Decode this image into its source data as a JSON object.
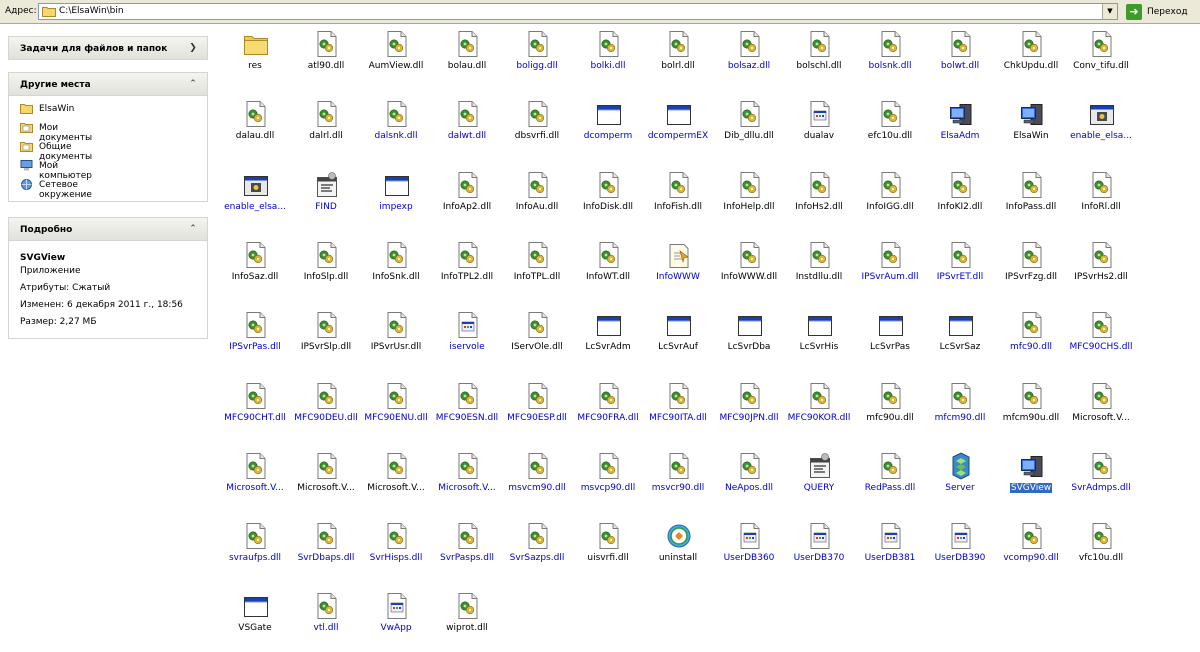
{
  "address": {
    "label": "Адрес:",
    "path": "C:\\ElsaWin\\bin",
    "go_label": "Переход"
  },
  "taskpane": {
    "file_tasks_title": "Задачи для файлов и папок",
    "other_places_title": "Другие места",
    "places": [
      {
        "label": "ElsaWin",
        "icon": "folder-icon"
      },
      {
        "label": "Мои документы",
        "icon": "my-documents-icon"
      },
      {
        "label": "Общие документы",
        "icon": "shared-documents-icon"
      },
      {
        "label": "Мой компьютер",
        "icon": "my-computer-icon"
      },
      {
        "label": "Сетевое окружение",
        "icon": "network-icon"
      }
    ],
    "details_title": "Подробно",
    "details": {
      "name": "SVGView",
      "type": "Приложение",
      "attributes": "Атрибуты: Сжатый",
      "modified": "Изменен: 6 декабря 2011 г., 18:56",
      "size": "Размер: 2,27 МБ"
    }
  },
  "colors": {
    "compressed_text": "#0000cc",
    "selection": "#316ac5",
    "toolbar": "#ece9d8"
  },
  "files": [
    {
      "name": "res",
      "type": "folder",
      "blue": false
    },
    {
      "name": "atl90.dll",
      "type": "dll",
      "blue": false
    },
    {
      "name": "AumView.dll",
      "type": "dll",
      "blue": false
    },
    {
      "name": "bolau.dll",
      "type": "dll",
      "blue": false
    },
    {
      "name": "boligg.dll",
      "type": "dll",
      "blue": true
    },
    {
      "name": "bolki.dll",
      "type": "dll",
      "blue": true
    },
    {
      "name": "bolrl.dll",
      "type": "dll",
      "blue": false
    },
    {
      "name": "bolsaz.dll",
      "type": "dll",
      "blue": true
    },
    {
      "name": "bolschl.dll",
      "type": "dll",
      "blue": false
    },
    {
      "name": "bolsnk.dll",
      "type": "dll",
      "blue": true
    },
    {
      "name": "bolwt.dll",
      "type": "dll",
      "blue": true
    },
    {
      "name": "ChkUpdu.dll",
      "type": "dll",
      "blue": false
    },
    {
      "name": "Conv_tifu.dll",
      "type": "dll",
      "blue": false
    },
    {
      "name": "dalau.dll",
      "type": "dll",
      "blue": false
    },
    {
      "name": "dalrl.dll",
      "type": "dll",
      "blue": false
    },
    {
      "name": "dalsnk.dll",
      "type": "dll",
      "blue": true
    },
    {
      "name": "dalwt.dll",
      "type": "dll",
      "blue": true
    },
    {
      "name": "dbsvrfi.dll",
      "type": "dll",
      "blue": false
    },
    {
      "name": "dcomperm",
      "type": "window",
      "blue": true
    },
    {
      "name": "dcompermEX",
      "type": "window",
      "blue": true
    },
    {
      "name": "Dib_dllu.dll",
      "type": "dll",
      "blue": false
    },
    {
      "name": "dualav",
      "type": "doc",
      "blue": false
    },
    {
      "name": "efc10u.dll",
      "type": "dll",
      "blue": false
    },
    {
      "name": "ElsaAdm",
      "type": "computer",
      "blue": true
    },
    {
      "name": "ElsaWin",
      "type": "computer",
      "blue": false
    },
    {
      "name": "enable_elsa...",
      "type": "appwin",
      "blue": true
    },
    {
      "name": "enable_elsa...",
      "type": "appwin",
      "blue": true
    },
    {
      "name": "FIND",
      "type": "batch",
      "blue": true
    },
    {
      "name": "impexp",
      "type": "window",
      "blue": true
    },
    {
      "name": "InfoAp2.dll",
      "type": "dll",
      "blue": false
    },
    {
      "name": "InfoAu.dll",
      "type": "dll",
      "blue": false
    },
    {
      "name": "InfoDisk.dll",
      "type": "dll",
      "blue": false
    },
    {
      "name": "InfoFish.dll",
      "type": "dll",
      "blue": false
    },
    {
      "name": "InfoHelp.dll",
      "type": "dll",
      "blue": false
    },
    {
      "name": "InfoHs2.dll",
      "type": "dll",
      "blue": false
    },
    {
      "name": "InfoIGG.dll",
      "type": "dll",
      "blue": false
    },
    {
      "name": "InfoKI2.dll",
      "type": "dll",
      "blue": false
    },
    {
      "name": "InfoPass.dll",
      "type": "dll",
      "blue": false
    },
    {
      "name": "InfoRl.dll",
      "type": "dll",
      "blue": false
    },
    {
      "name": "InfoSaz.dll",
      "type": "dll",
      "blue": false
    },
    {
      "name": "InfoSlp.dll",
      "type": "dll",
      "blue": false
    },
    {
      "name": "InfoSnk.dll",
      "type": "dll",
      "blue": false
    },
    {
      "name": "InfoTPL2.dll",
      "type": "dll",
      "blue": false
    },
    {
      "name": "InfoTPL.dll",
      "type": "dll",
      "blue": false
    },
    {
      "name": "InfoWT.dll",
      "type": "dll",
      "blue": false
    },
    {
      "name": "InfoWWW",
      "type": "wizard",
      "blue": true
    },
    {
      "name": "InfoWWW.dll",
      "type": "dll",
      "blue": false
    },
    {
      "name": "Instdllu.dll",
      "type": "dll",
      "blue": false
    },
    {
      "name": "IPSvrAum.dll",
      "type": "dll",
      "blue": true
    },
    {
      "name": "IPSvrET.dll",
      "type": "dll",
      "blue": true
    },
    {
      "name": "IPSvrFzg.dll",
      "type": "dll",
      "blue": false
    },
    {
      "name": "IPSvrHs2.dll",
      "type": "dll",
      "blue": false
    },
    {
      "name": "IPSvrPas.dll",
      "type": "dll",
      "blue": true
    },
    {
      "name": "IPSvrSlp.dll",
      "type": "dll",
      "blue": false
    },
    {
      "name": "IPSvrUsr.dll",
      "type": "dll",
      "blue": false
    },
    {
      "name": "iservole",
      "type": "doc",
      "blue": true
    },
    {
      "name": "IServOle.dll",
      "type": "dll",
      "blue": false
    },
    {
      "name": "LcSvrAdm",
      "type": "window",
      "blue": false
    },
    {
      "name": "LcSvrAuf",
      "type": "window",
      "blue": false
    },
    {
      "name": "LcSvrDba",
      "type": "window",
      "blue": false
    },
    {
      "name": "LcSvrHis",
      "type": "window",
      "blue": false
    },
    {
      "name": "LcSvrPas",
      "type": "window",
      "blue": false
    },
    {
      "name": "LcSvrSaz",
      "type": "window",
      "blue": false
    },
    {
      "name": "mfc90.dll",
      "type": "dll",
      "blue": true
    },
    {
      "name": "MFC90CHS.dll",
      "type": "dll",
      "blue": true
    },
    {
      "name": "MFC90CHT.dll",
      "type": "dll",
      "blue": true
    },
    {
      "name": "MFC90DEU.dll",
      "type": "dll",
      "blue": true
    },
    {
      "name": "MFC90ENU.dll",
      "type": "dll",
      "blue": true
    },
    {
      "name": "MFC90ESN.dll",
      "type": "dll",
      "blue": true
    },
    {
      "name": "MFC90ESP.dll",
      "type": "dll",
      "blue": true
    },
    {
      "name": "MFC90FRA.dll",
      "type": "dll",
      "blue": true
    },
    {
      "name": "MFC90ITA.dll",
      "type": "dll",
      "blue": true
    },
    {
      "name": "MFC90JPN.dll",
      "type": "dll",
      "blue": true
    },
    {
      "name": "MFC90KOR.dll",
      "type": "dll",
      "blue": true
    },
    {
      "name": "mfc90u.dll",
      "type": "dll",
      "blue": false
    },
    {
      "name": "mfcm90.dll",
      "type": "dll",
      "blue": true
    },
    {
      "name": "mfcm90u.dll",
      "type": "dll",
      "blue": false
    },
    {
      "name": "Microsoft.V...",
      "type": "dll",
      "blue": false
    },
    {
      "name": "Microsoft.V...",
      "type": "dll",
      "blue": true
    },
    {
      "name": "Microsoft.V...",
      "type": "dll",
      "blue": false
    },
    {
      "name": "Microsoft.V...",
      "type": "dll",
      "blue": false
    },
    {
      "name": "Microsoft.V...",
      "type": "dll",
      "blue": true
    },
    {
      "name": "msvcm90.dll",
      "type": "dll",
      "blue": true
    },
    {
      "name": "msvcp90.dll",
      "type": "dll",
      "blue": true
    },
    {
      "name": "msvcr90.dll",
      "type": "dll",
      "blue": true
    },
    {
      "name": "NeApos.dll",
      "type": "dll",
      "blue": true
    },
    {
      "name": "QUERY",
      "type": "batch",
      "blue": true
    },
    {
      "name": "RedPass.dll",
      "type": "dll",
      "blue": true
    },
    {
      "name": "Server",
      "type": "server",
      "blue": true
    },
    {
      "name": "SVGView",
      "type": "computer",
      "blue": false,
      "selected": true
    },
    {
      "name": "SvrAdmps.dll",
      "type": "dll",
      "blue": true
    },
    {
      "name": "svraufps.dll",
      "type": "dll",
      "blue": true
    },
    {
      "name": "SvrDbaps.dll",
      "type": "dll",
      "blue": true
    },
    {
      "name": "SvrHisps.dll",
      "type": "dll",
      "blue": true
    },
    {
      "name": "SvrPasps.dll",
      "type": "dll",
      "blue": true
    },
    {
      "name": "SvrSazps.dll",
      "type": "dll",
      "blue": true
    },
    {
      "name": "uisvrfi.dll",
      "type": "dll",
      "blue": false
    },
    {
      "name": "uninstall",
      "type": "globe",
      "blue": false
    },
    {
      "name": "UserDB360",
      "type": "doc",
      "blue": true
    },
    {
      "name": "UserDB370",
      "type": "doc",
      "blue": true
    },
    {
      "name": "UserDB381",
      "type": "doc",
      "blue": true
    },
    {
      "name": "UserDB390",
      "type": "doc",
      "blue": true
    },
    {
      "name": "vcomp90.dll",
      "type": "dll",
      "blue": true
    },
    {
      "name": "vfc10u.dll",
      "type": "dll",
      "blue": false
    },
    {
      "name": "VSGate",
      "type": "window",
      "blue": false
    },
    {
      "name": "vtl.dll",
      "type": "dll",
      "blue": true
    },
    {
      "name": "VwApp",
      "type": "doc",
      "blue": true
    },
    {
      "name": "wiprot.dll",
      "type": "dll",
      "blue": false
    }
  ]
}
